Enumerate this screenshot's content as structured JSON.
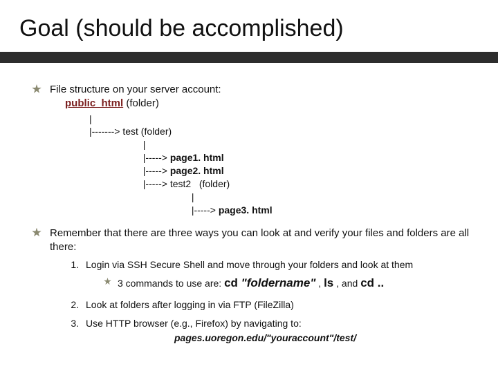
{
  "title": "Goal (should be accomplished)",
  "bullet1": {
    "text": "File structure on your server account:",
    "folder_label": "public_html",
    "folder_suffix": " (folder)",
    "tree_pipe1": "         |",
    "tree_test_prefix": "         |-------> ",
    "tree_test": "test (folder)",
    "tree_pipe2": "                             |",
    "tree_p1_prefix": "                             |-----> ",
    "tree_p1": "page1. html",
    "tree_p2_prefix": "                             |-----> ",
    "tree_p2": "page2. html",
    "tree_t2_prefix": "                             |-----> ",
    "tree_t2": "test2   (folder)",
    "tree_pipe3": "                                               |",
    "tree_p3_prefix": "                                               |-----> ",
    "tree_p3": "page3. html"
  },
  "bullet2": {
    "text": "Remember that there are three ways you can look at and verify your files and folders are all there:",
    "item1": "Login via SSH Secure Shell and move through your folders and look at them",
    "cmds_intro": "3 commands to use are: ",
    "cmds_cd": "cd ",
    "cmds_arg": "\"foldername\"",
    "cmds_comma1": " , ",
    "cmds_ls": "ls",
    "cmds_comma2": " , and ",
    "cmds_cdup": "cd ..",
    "item2": "Look at folders after logging in via FTP  (FileZilla)",
    "item3": "Use HTTP browser (e.g., Firefox) by navigating to:",
    "url": "pages.uoregon.edu/\"youraccount\"/test/"
  }
}
